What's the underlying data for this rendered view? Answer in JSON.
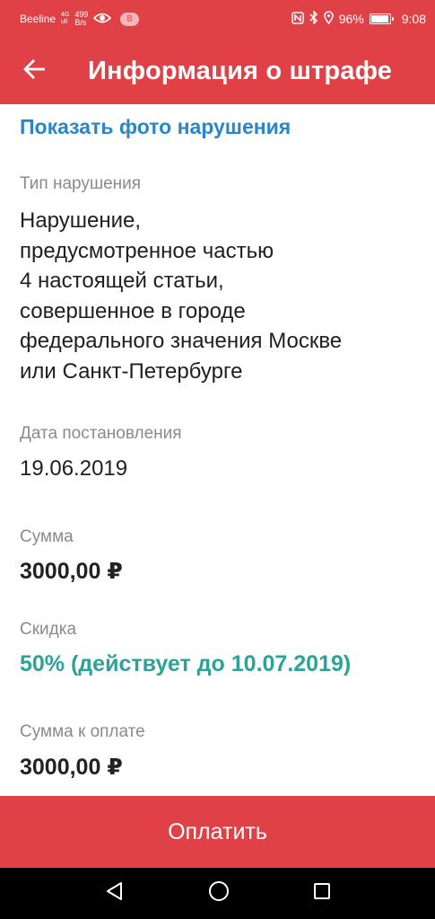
{
  "status_bar": {
    "carrier": "Beeline",
    "network_top": "4G",
    "network_bottom": "ull",
    "speed_value": "499",
    "speed_unit": "B/s",
    "notification_count": "8",
    "battery": "96%",
    "time": "9:08"
  },
  "header": {
    "title": "Информация о штрафе"
  },
  "content": {
    "photo_link": "Показать фото нарушения",
    "violation_type_label": "Тип нарушения",
    "violation_type_lines": [
      "Нарушение,",
      "предусмотренное частью",
      "4 настоящей статьи,",
      "совершенное в городе",
      "федерального значения Москве",
      "или Санкт-Петербурге"
    ],
    "decision_date_label": "Дата постановления",
    "decision_date": "19.06.2019",
    "amount_label": "Сумма",
    "amount": "3000,00 ₽",
    "discount_label": "Скидка",
    "discount": "50% (действует до 10.07.2019)",
    "amount_due_label": "Сумма к оплате",
    "amount_due": "3000,00 ₽"
  },
  "actions": {
    "pay_label": "Оплатить"
  },
  "icons": {
    "back": "arrow-left-icon",
    "nav_back": "triangle-back-icon",
    "nav_home": "circle-home-icon",
    "nav_recents": "square-recents-icon"
  },
  "colors": {
    "brand_red": "#e04146",
    "link_blue": "#2a86c9",
    "discount_teal": "#2ca39a"
  }
}
